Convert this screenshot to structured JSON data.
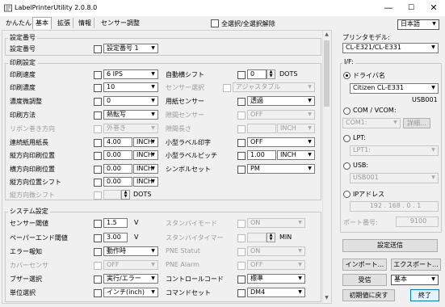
{
  "window": {
    "title": "LabelPrinterUtility 2.0.8.0",
    "min": "—",
    "max": "☐",
    "close": "✕"
  },
  "tabs": [
    "かんたん",
    "基本",
    "拡張",
    "情報",
    "センサー調整"
  ],
  "select_all_label": "全選択/全選択解除",
  "language": "日本語",
  "setting_number": {
    "section": "設定番号",
    "label": "設定番号",
    "value": "設定番号 1"
  },
  "print_settings": {
    "section": "印刷設定",
    "speed": {
      "label": "印刷速度",
      "value": "6 IPS"
    },
    "density": {
      "label": "印刷濃度",
      "value": "10"
    },
    "density_adjust": {
      "label": "濃度微調整",
      "value": "0"
    },
    "method": {
      "label": "印刷方法",
      "value": "熱転写"
    },
    "ribbon_winding": {
      "label": "リボン巻き方向",
      "value": "外巻き"
    },
    "continuous_length": {
      "label": "連続紙用紙長",
      "value": "4.00",
      "unit": "INCH"
    },
    "vertical_pos": {
      "label": "縦方向印刷位置",
      "value": "0.00",
      "unit": "INCH"
    },
    "horizontal_pos": {
      "label": "横方向印刷位置",
      "value": "0.00",
      "unit": "INCH"
    },
    "vertical_shift": {
      "label": "縦方向位置シフト",
      "value": "0.00",
      "unit": "INCH"
    },
    "vertical_fine_shift": {
      "label": "縦方向微シフト",
      "unit": "DOTS"
    },
    "auto_shift": {
      "label": "自動横シフト",
      "value": "0",
      "unit": "DOTS"
    },
    "sensor_select": {
      "label": "センサー選択",
      "value": "アジャスタブル"
    },
    "paper_sensor": {
      "label": "用紙センサー",
      "value": "透過"
    },
    "reflect_sensor": {
      "label": "隙間センサー",
      "value": "OFF"
    },
    "gap_length": {
      "label": "隙間長さ",
      "unit": "INCH"
    },
    "small_label_print": {
      "label": "小型ラベル印字",
      "value": "OFF"
    },
    "small_label_pitch": {
      "label": "小型ラベルピッチ",
      "value": "1.00",
      "unit": "INCH"
    },
    "symbol_set": {
      "label": "シンボルセット",
      "value": "PM"
    }
  },
  "system_settings": {
    "section": "システム設定",
    "sensor_threshold": {
      "label": "センサー閾値",
      "value": "1.5",
      "unit": "V"
    },
    "paper_end_threshold": {
      "label": "ペーパーエンド閾値",
      "value": "3.00",
      "unit": "V"
    },
    "error_notify": {
      "label": "エラー報知",
      "value": "動作時"
    },
    "cover_sensor": {
      "label": "カバーセンサ",
      "value": "OFF"
    },
    "buzzer": {
      "label": "ブザー選択",
      "value": "実行/エラー"
    },
    "unit": {
      "label": "単位選択",
      "value": "インチ(inch)"
    },
    "standby_mode": {
      "label": "スタンバイモード",
      "value": "ON"
    },
    "standby_timer": {
      "label": "スタンバイタイマー",
      "unit": "MIN"
    },
    "pne_status": {
      "label": "PNE Statut",
      "value": "ON"
    },
    "pne_alarm": {
      "label": "PNE Alarm",
      "value": "OFF"
    },
    "control_code": {
      "label": "コントロールコード",
      "value": "標準"
    },
    "command_set": {
      "label": "コマンドセット",
      "value": "DM4"
    }
  },
  "right_panel": {
    "model_label": "プリンタモデル:",
    "model_value": "CL-E321/CL-E331",
    "if_label": "I/F:",
    "driver_label": "ドライバ名",
    "driver_value": "Citizen CL-E331",
    "port_value": "USB001",
    "com_label": "COM / VCOM:",
    "com_value": "COM1:",
    "com_detail": "詳細...",
    "lpt_label": "LPT:",
    "lpt_value": "LPT1:",
    "usb_label": "USB:",
    "usb_value": "USB001",
    "ip_label": "IPアドレス",
    "ip_value": "192 . 168 . 0 . 1",
    "port_label": "ポート番号:",
    "port_number": "9100",
    "send_button": "設定送信",
    "import_button": "インポート...",
    "export_button": "エクスポート...",
    "receive_button": "受信",
    "receive_mode": "基本",
    "reset_button": "初期値に戻す",
    "exit_button": "終了"
  }
}
